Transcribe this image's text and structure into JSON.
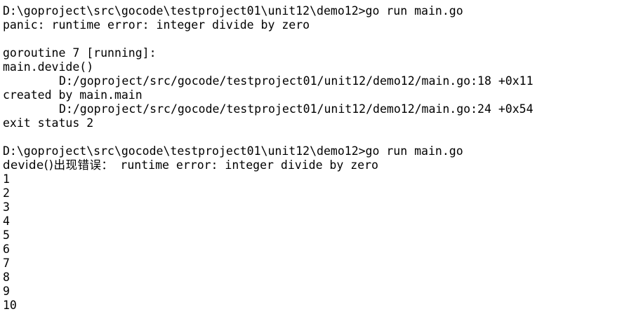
{
  "terminal": {
    "first_run": {
      "prompt_command": "D:\\goproject\\src\\gocode\\testproject01\\unit12\\demo12>go run main.go",
      "panic_line": "panic: runtime error: integer divide by zero",
      "goroutine_line": "goroutine 7 [running]:",
      "frame1_func": "main.devide()",
      "frame1_path": "D:/goproject/src/gocode/testproject01/unit12/demo12/main.go:18 +0x11",
      "created_by": "created by main.main",
      "frame2_path": "D:/goproject/src/gocode/testproject01/unit12/demo12/main.go:24 +0x54",
      "exit_status": "exit status 2"
    },
    "second_run": {
      "prompt_command": "D:\\goproject\\src\\gocode\\testproject01\\unit12\\demo12>go run main.go",
      "recover_prefix": "devide()出现错误：",
      "recover_message": " runtime error: integer divide by zero",
      "numbers": [
        "1",
        "2",
        "3",
        "4",
        "5",
        "6",
        "7",
        "8",
        "9",
        "10"
      ]
    }
  }
}
